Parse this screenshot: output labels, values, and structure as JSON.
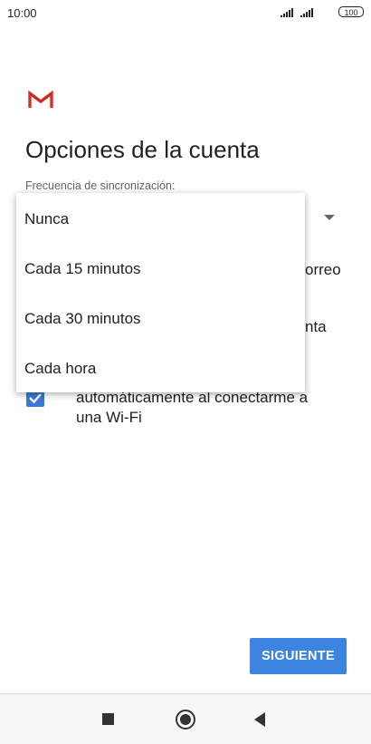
{
  "status_bar": {
    "time": "10:00",
    "battery": "100"
  },
  "screen": {
    "title": "Opciones de la cuenta",
    "sync_frequency_label": "Frecuencia de sincronización:",
    "partial_line_1": "orreo",
    "partial_line_2": "nta",
    "wifi_line_1": "automáticamente al conectarme a",
    "wifi_line_2": "una Wi-Fi",
    "wifi_checked": true
  },
  "dropdown_menu": {
    "items": [
      "Nunca",
      "Cada 15 minutos",
      "Cada 30 minutos",
      "Cada hora"
    ]
  },
  "actions": {
    "next_label": "SIGUIENTE"
  },
  "colors": {
    "accent": "#3c84e0",
    "gmail_red": "#d93025"
  },
  "icons": {
    "logo": "gmail-logo-icon",
    "nav": [
      "recent-apps-icon",
      "home-icon",
      "back-icon"
    ]
  }
}
